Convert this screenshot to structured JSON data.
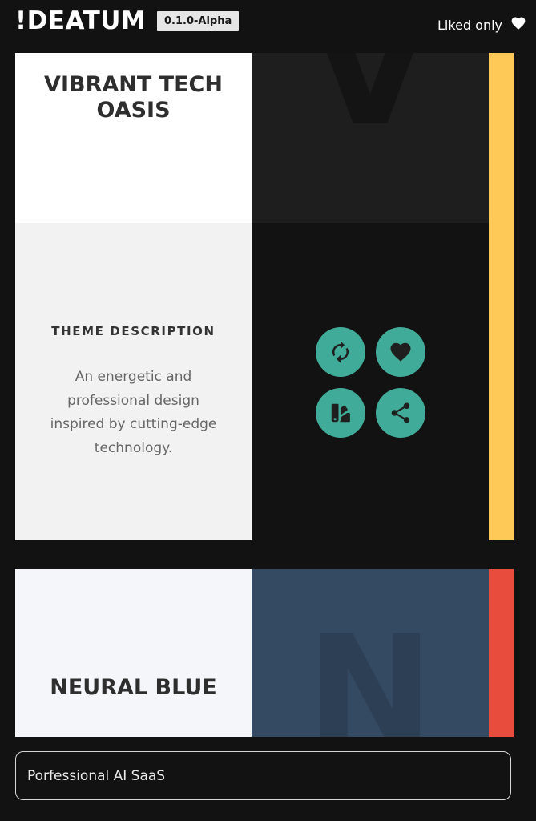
{
  "header": {
    "logo": "!DEATUM",
    "version": "0.1.0-Alpha",
    "liked_only_label": "Liked only"
  },
  "themes": [
    {
      "title": "VIBRANT TECH OASIS",
      "description_heading": "THEME DESCRIPTION",
      "description": "An energetic and professional design inspired by cutting-edge technology.",
      "watermark_letter": "V",
      "accent_color": "#fec957",
      "preview_color": "#1e1e1e",
      "actions": [
        "refresh-icon",
        "heart-icon",
        "palette-icon",
        "share-icon"
      ]
    },
    {
      "title": "NEURAL BLUE",
      "watermark_letter": "N",
      "accent_color": "#e74c3c",
      "preview_color": "#344a62"
    }
  ],
  "prompt": {
    "value": "Porfessional AI SaaS"
  },
  "colors": {
    "background": "#121212",
    "action_button": "#40ab98"
  }
}
